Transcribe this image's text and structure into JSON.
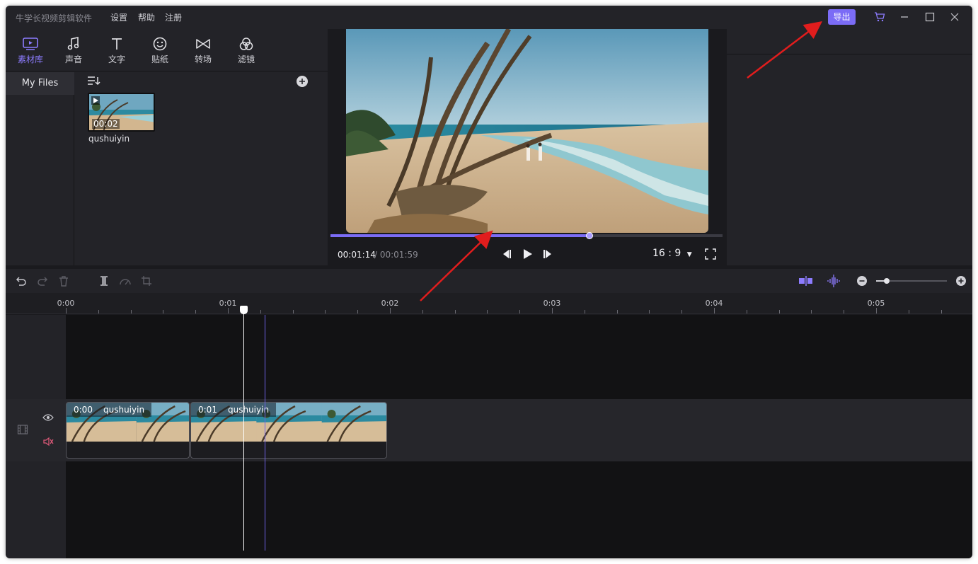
{
  "app": {
    "title": "牛学长视频剪辑软件",
    "menu": [
      "设置",
      "帮助",
      "注册"
    ],
    "export_label": "导出",
    "accent": "#7b6cf6"
  },
  "tabs": [
    {
      "label": "素材库",
      "icon": "media-library-icon",
      "active": true
    },
    {
      "label": "声音",
      "icon": "music-note-icon"
    },
    {
      "label": "文字",
      "icon": "text-icon"
    },
    {
      "label": "贴纸",
      "icon": "sticker-icon"
    },
    {
      "label": "转场",
      "icon": "transition-icon"
    },
    {
      "label": "滤镜",
      "icon": "filter-icon"
    }
  ],
  "library": {
    "nav": [
      "My Files"
    ],
    "files": [
      {
        "name": "qushuiyin",
        "duration": "00:02"
      }
    ]
  },
  "preview": {
    "current_time": "00:01:14",
    "total_time": "/ 00:01:59",
    "progress": 0.66,
    "aspect_ratio": "16 : 9"
  },
  "timeline": {
    "ruler_labels": [
      "0:00",
      "0:01",
      "0:02",
      "0:03",
      "0:04",
      "0:05"
    ],
    "playhead_seconds": 1.1,
    "clips": [
      {
        "time": "0:00",
        "name": "qushuiyin"
      },
      {
        "time": "0:01",
        "name": "qushuiyin"
      }
    ]
  }
}
